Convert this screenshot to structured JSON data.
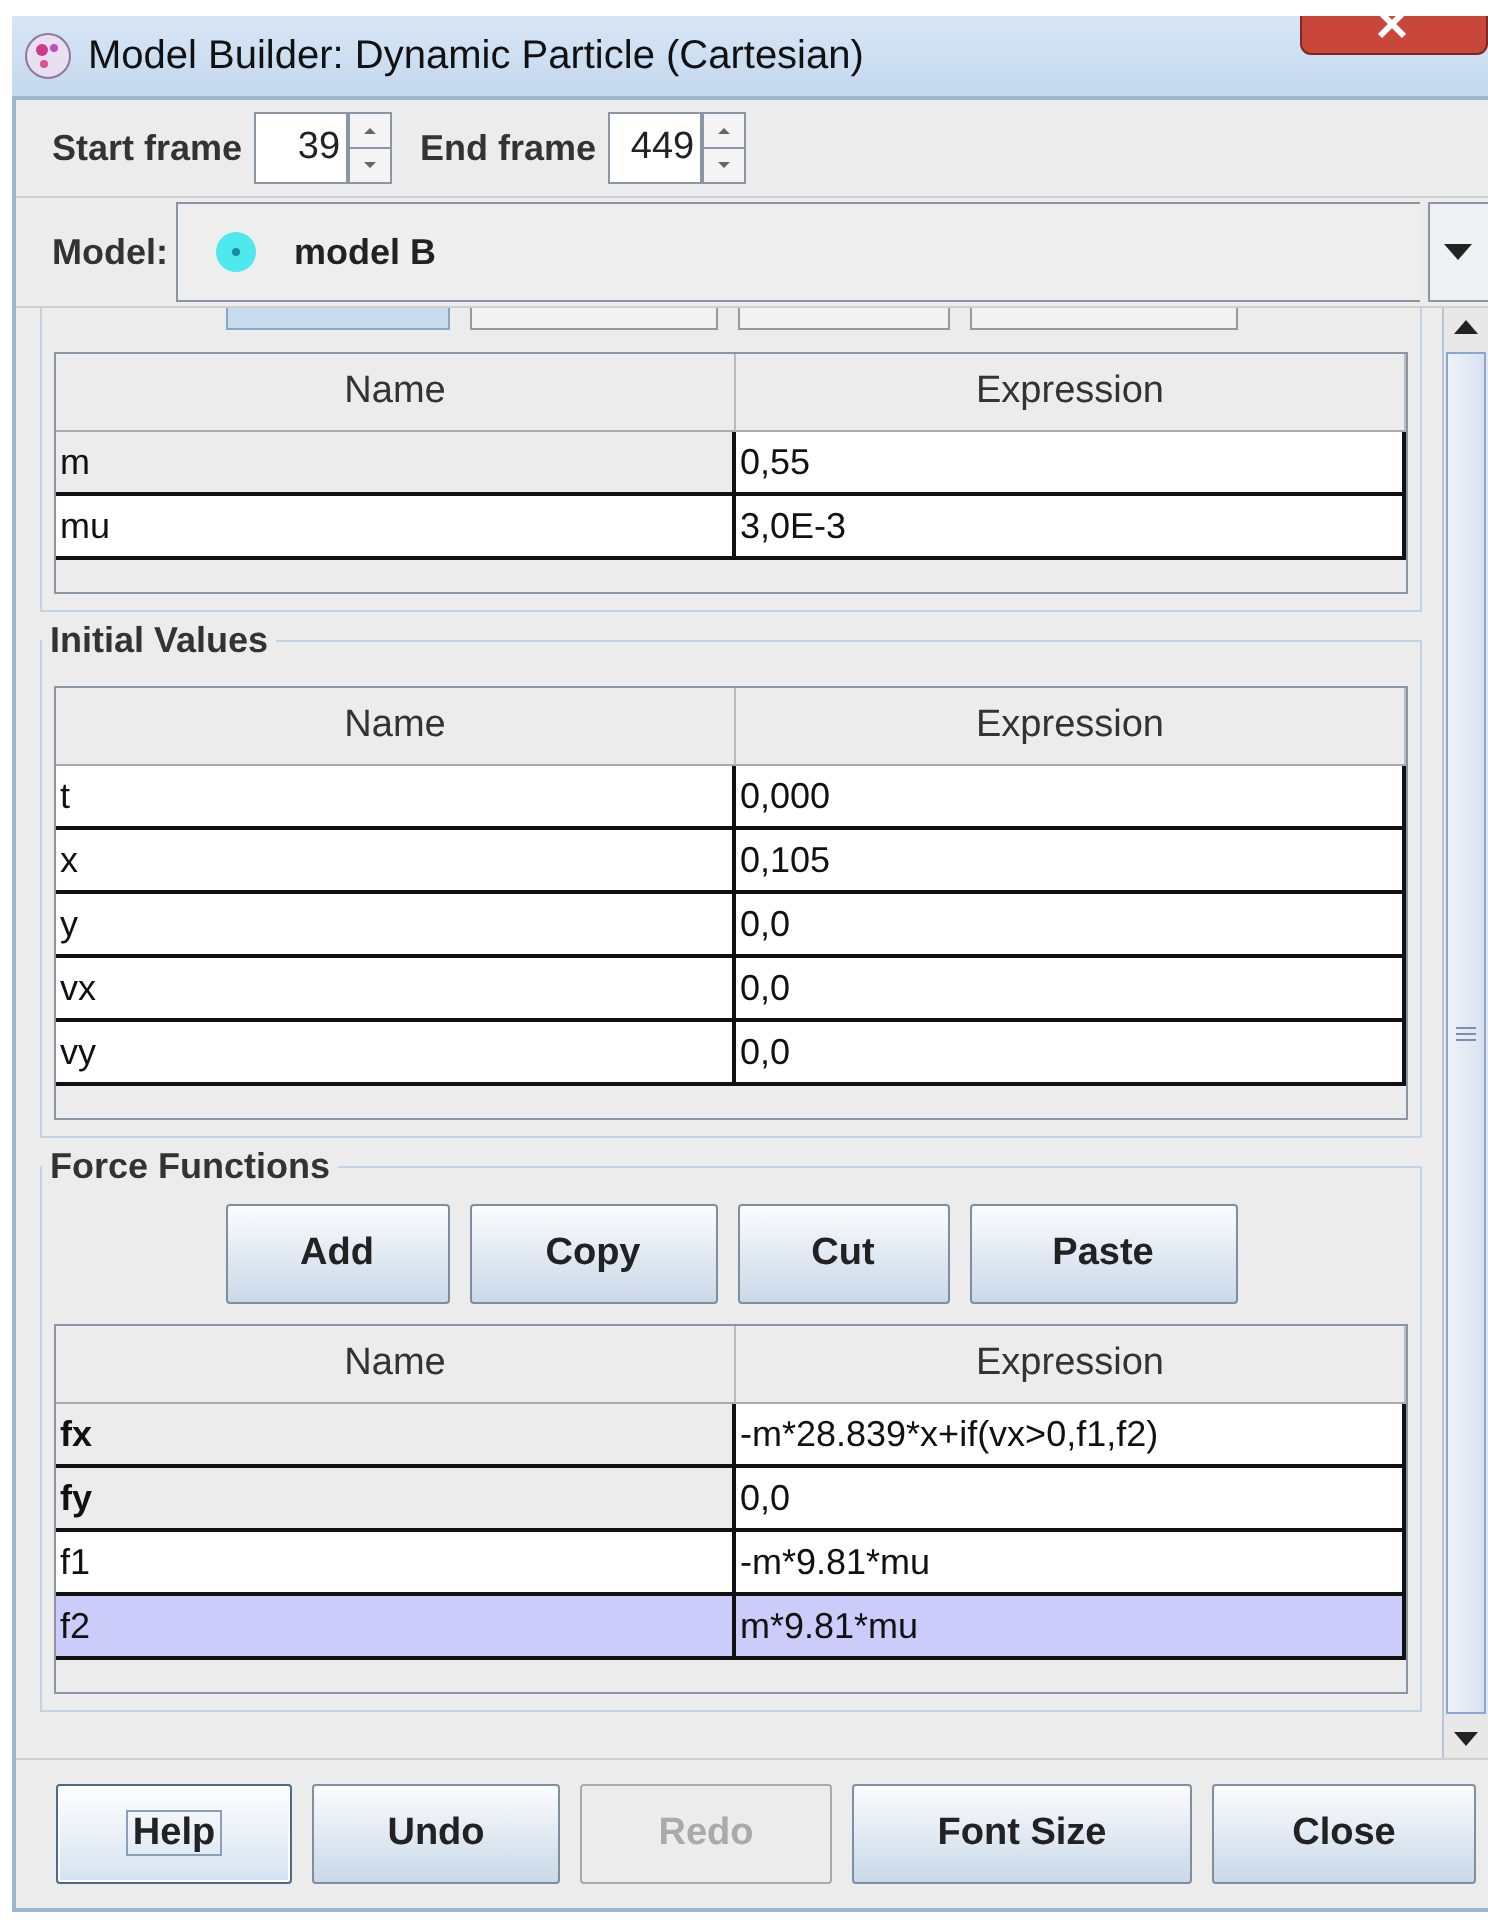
{
  "window": {
    "title": "Model Builder: Dynamic Particle (Cartesian)"
  },
  "frames": {
    "start_label": "Start frame",
    "start_value": "39",
    "end_label": "End frame",
    "end_value": "449"
  },
  "model": {
    "label": "Model:",
    "value": "model B"
  },
  "parameters": {
    "partial_buttons": [
      {
        "highlighted": true
      },
      {
        "highlighted": false
      },
      {
        "highlighted": false
      },
      {
        "highlighted": false
      }
    ],
    "columns": [
      "Name",
      "Expression"
    ],
    "rows": [
      {
        "name": "m",
        "expression": "0,55",
        "shaded": true,
        "bold": false,
        "selected": false
      },
      {
        "name": "mu",
        "expression": "3,0E-3",
        "shaded": false,
        "bold": false,
        "selected": false
      }
    ]
  },
  "initial_values": {
    "title": "Initial Values",
    "columns": [
      "Name",
      "Expression"
    ],
    "rows": [
      {
        "name": "t",
        "expression": "0,000",
        "shaded": false,
        "bold": false,
        "selected": false
      },
      {
        "name": "x",
        "expression": "0,105",
        "shaded": false,
        "bold": false,
        "selected": false
      },
      {
        "name": "y",
        "expression": "0,0",
        "shaded": false,
        "bold": false,
        "selected": false
      },
      {
        "name": "vx",
        "expression": "0,0",
        "shaded": false,
        "bold": false,
        "selected": false
      },
      {
        "name": "vy",
        "expression": "0,0",
        "shaded": false,
        "bold": false,
        "selected": false
      }
    ]
  },
  "force_functions": {
    "title": "Force Functions",
    "buttons": [
      "Add",
      "Copy",
      "Cut",
      "Paste"
    ],
    "columns": [
      "Name",
      "Expression"
    ],
    "rows": [
      {
        "name": "fx",
        "expression": "-m*28.839*x+if(vx>0,f1,f2)",
        "shaded": true,
        "bold": true,
        "selected": false
      },
      {
        "name": "fy",
        "expression": "0,0",
        "shaded": true,
        "bold": true,
        "selected": false
      },
      {
        "name": "f1",
        "expression": "-m*9.81*mu",
        "shaded": false,
        "bold": false,
        "selected": false
      },
      {
        "name": "f2",
        "expression": "m*9.81*mu",
        "shaded": false,
        "bold": false,
        "selected": true
      }
    ]
  },
  "buttons": [
    {
      "label": "Help",
      "focused": true,
      "disabled": false
    },
    {
      "label": "Undo",
      "focused": false,
      "disabled": false
    },
    {
      "label": "Redo",
      "focused": false,
      "disabled": true
    },
    {
      "label": "Font Size",
      "focused": false,
      "disabled": false
    },
    {
      "label": "Close",
      "focused": false,
      "disabled": false
    }
  ]
}
